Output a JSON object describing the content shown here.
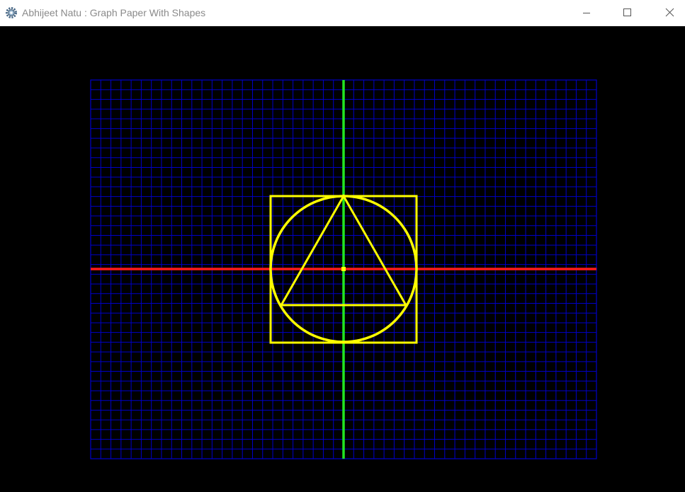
{
  "window": {
    "title": "Abhijeet Natu : Graph Paper With Shapes",
    "app_icon": "gear-icon",
    "controls": [
      "minimize-icon",
      "maximize-icon",
      "close-icon"
    ]
  },
  "canvas": {
    "background_color": "#000000",
    "grid_color": "#0000c8",
    "x_axis_color": "#ff1a1a",
    "y_axis_color": "#22e622",
    "shape_color": "#ffff00",
    "shapes": [
      "square",
      "circle",
      "triangle",
      "center-point"
    ]
  }
}
